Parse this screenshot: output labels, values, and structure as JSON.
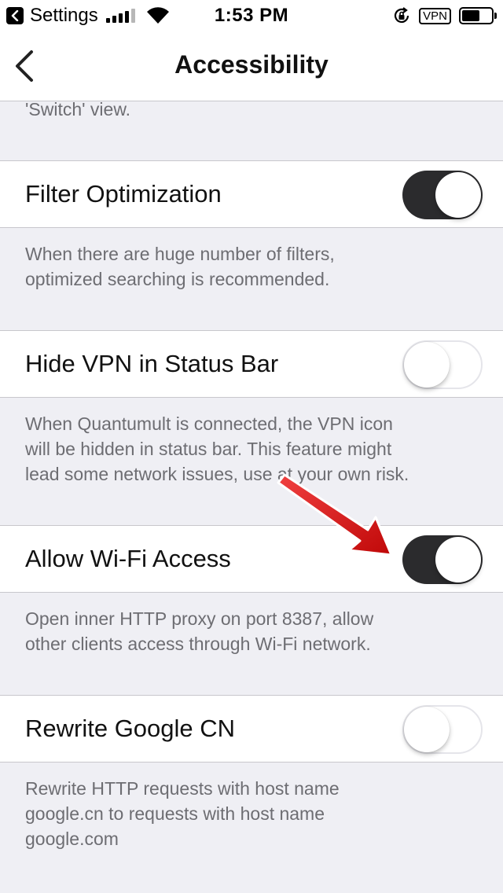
{
  "status_bar": {
    "back_app": "Settings",
    "time": "1:53 PM",
    "vpn_label": "VPN"
  },
  "nav": {
    "title": "Accessibility"
  },
  "top_footer": "'Switch' view.",
  "settings": [
    {
      "label": "Filter Optimization",
      "enabled": true,
      "description": [
        "When there are huge number of filters,",
        "optimized searching is recommended."
      ]
    },
    {
      "label": "Hide VPN in Status Bar",
      "enabled": false,
      "description": [
        "When Quantumult is connected, the VPN icon",
        "will be hidden in status bar. This feature might",
        "lead some network issues, use at your own risk."
      ]
    },
    {
      "label": "Allow Wi-Fi Access",
      "enabled": true,
      "description": [
        "Open inner HTTP proxy on port 8387, allow",
        "other clients access through Wi-Fi network."
      ]
    },
    {
      "label": "Rewrite Google CN",
      "enabled": false,
      "description": [
        "Rewrite HTTP requests with host name",
        "google.cn to requests with host name",
        "google.com"
      ]
    }
  ],
  "colors": {
    "toggle_on": "#2b2b2d",
    "arrow": "#e02020",
    "footer_text": "#6d6d72"
  }
}
